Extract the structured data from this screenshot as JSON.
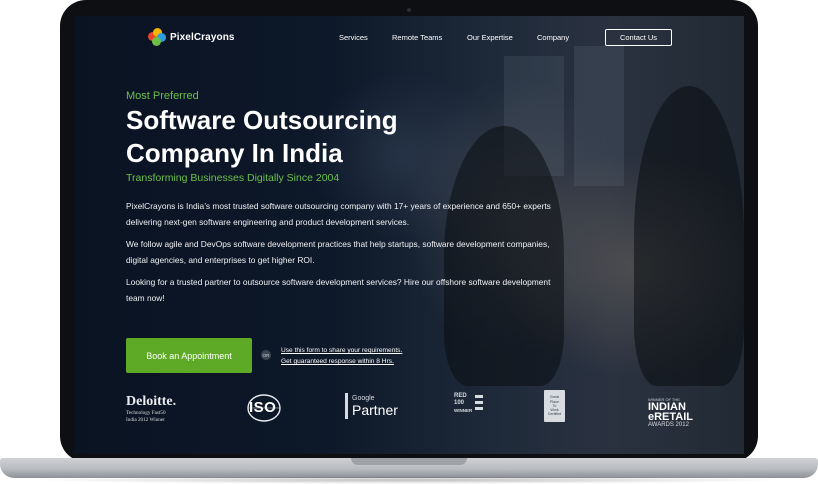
{
  "nav": {
    "logo_text": "PixelCrayons",
    "items": [
      "Services",
      "Remote Teams",
      "Our Expertise",
      "Company"
    ],
    "contact_label": "Contact Us"
  },
  "hero": {
    "eyebrow": "Most Preferred",
    "headline_line1": "Software Outsourcing",
    "headline_line2": "Company In India",
    "tagline": "Transforming Businesses Digitally Since 2004",
    "paragraphs": [
      "PixelCrayons is India’s most trusted software outsourcing company with 17+ years of experience and 650+ experts delivering next-gen software engineering and product development services.",
      "We follow agile and DevOps software development practices that help startups, software development companies, digital agencies, and enterprises to get higher ROI.",
      "Looking for a trusted partner to outsource software development services? Hire our offshore software development team now!"
    ],
    "cta_label": "Book an Appointment",
    "or_label": "OR",
    "note_line1": "Use this form to share your requirements.",
    "note_line2": "Get guaranteed response within 8 Hrs."
  },
  "trust": {
    "deloitte": {
      "name": "Deloitte.",
      "sub1": "Technology Fast50",
      "sub2": "India 2012 Winner"
    },
    "iso": {
      "text": "ISO"
    },
    "google_partner": {
      "small": "Google",
      "large": "Partner"
    },
    "red_herring": {
      "line1": "RED",
      "line2": "100",
      "line3": "WINNER"
    },
    "gptw": {
      "line1": "Great",
      "line2": "Place",
      "line3": "To",
      "line4": "Work",
      "line5": "Certified"
    },
    "indian_retail": {
      "small": "WINNER OF THE",
      "line1": "INDIAN",
      "line2": "eRETAIL",
      "awards": "AWARDS 2012"
    }
  },
  "colors": {
    "accent_green": "#5eaa27",
    "eyebrow_green": "#6cc04a",
    "background": "#0d1829"
  }
}
